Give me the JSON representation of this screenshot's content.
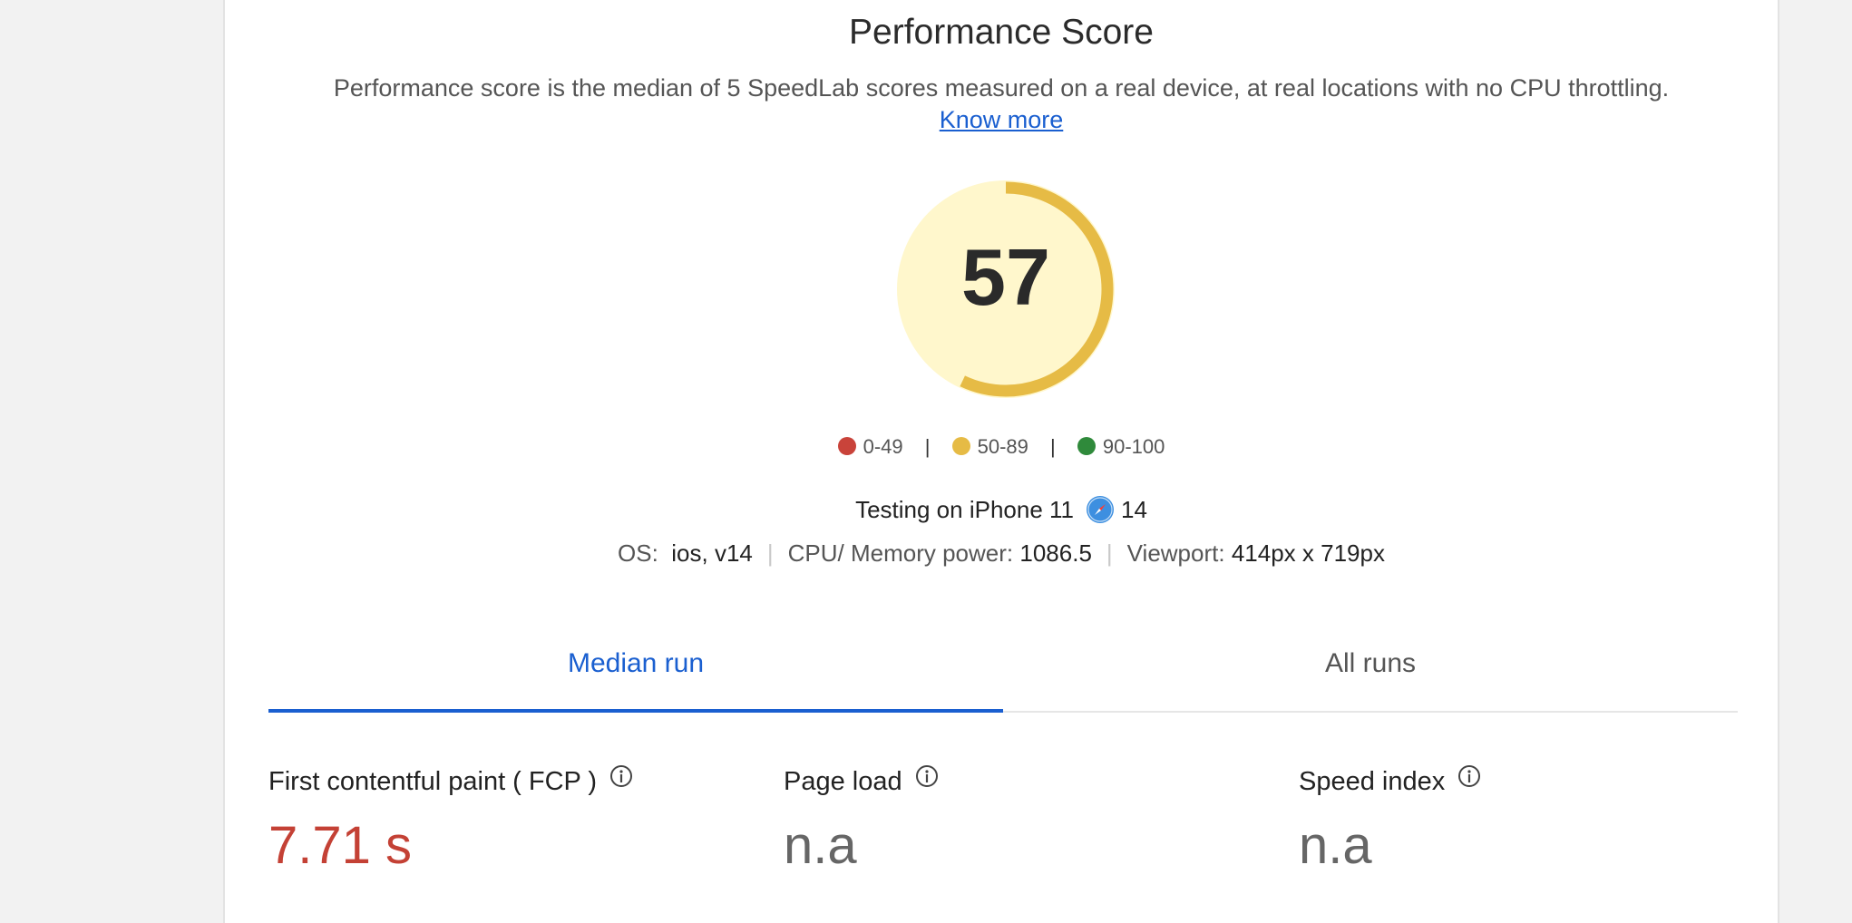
{
  "header": {
    "title": "Performance Score",
    "subtitle": "Performance score is the median of 5 SpeedLab scores measured on a real device, at real locations with no CPU throttling.",
    "link_label": "Know more"
  },
  "score": {
    "value": "57",
    "fraction": 0.57,
    "ring_color": "#e6bb45",
    "fill_color": "#fff7cc"
  },
  "legend": [
    {
      "label": "0-49",
      "color": "#c9433a"
    },
    {
      "label": "50-89",
      "color": "#e6bb45"
    },
    {
      "label": "90-100",
      "color": "#2f8a3b"
    }
  ],
  "device": {
    "prefix": "Testing on iPhone 11",
    "browser_icon": "safari-icon",
    "browser_version": "14"
  },
  "specs": {
    "os_label": "OS:",
    "os_value": "ios, v14",
    "cpu_label": "CPU/ Memory power:",
    "cpu_value": "1086.5",
    "viewport_label": "Viewport:",
    "viewport_value": "414px x 719px"
  },
  "tabs": [
    {
      "label": "Median run",
      "active": true
    },
    {
      "label": "All runs",
      "active": false
    }
  ],
  "metrics": [
    {
      "label": "First contentful paint ( FCP )",
      "value": "7.71 s",
      "status": "bad"
    },
    {
      "label": "Page load",
      "value": "n.a",
      "status": "na"
    },
    {
      "label": "Speed index",
      "value": "n.a",
      "status": "na"
    }
  ],
  "colors": {
    "accent": "#1a5fd0",
    "bad": "#c44135"
  }
}
